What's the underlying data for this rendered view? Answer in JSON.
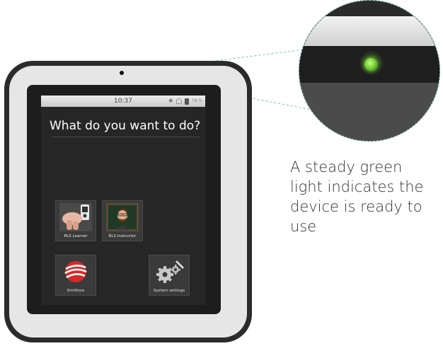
{
  "status_bar": {
    "time": "10:37",
    "battery": "78 %"
  },
  "screen": {
    "prompt": "What do you want to do?"
  },
  "apps": [
    {
      "label": "BLS Learner"
    },
    {
      "label": "BLS Instructor"
    },
    {
      "label": "SimStore"
    },
    {
      "label": "System settings"
    }
  ],
  "callout": {
    "caption": "A steady green light indicates the device is ready to use"
  },
  "colors": {
    "led_green": "#62c21f",
    "callout_line": "#7fbfbf",
    "screen_bg": "#262626"
  }
}
